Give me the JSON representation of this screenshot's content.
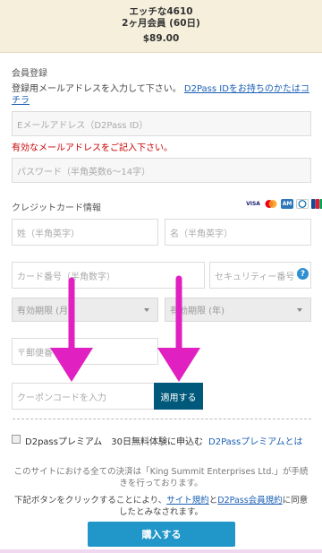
{
  "header": {
    "title": "エッチな4610",
    "plan": "2ヶ月会員 (60日)",
    "price": "$89.00"
  },
  "registration": {
    "section_label": "会員登録",
    "instruction": "登録用メールアドレスを入力して下さい。",
    "d2pass_link": "D2Pass IDをお持ちのかたはコチラ",
    "email_placeholder": "Eメールアドレス（D2Pass ID）",
    "email_error": "有効なメールアドレスをご記入下さい。",
    "password_placeholder": "パスワード（半角英数6〜14字）"
  },
  "credit_card": {
    "section_label": "クレジットカード情報",
    "brands": [
      "VISA",
      "MC",
      "AMEX",
      "DC",
      "JCB"
    ],
    "last_name_placeholder": "姓（半角英字）",
    "first_name_placeholder": "名（半角英字）",
    "card_number_placeholder": "カード番号（半角数字）",
    "security_placeholder": "セキュリティー番号",
    "help_icon": "?",
    "exp_month": "有効期限 (月)",
    "exp_year": "有効期限 (年)",
    "postal_placeholder": "〒郵便番号"
  },
  "coupon": {
    "placeholder": "クーポンコードを入力",
    "apply_label": "適用する"
  },
  "premium": {
    "label": "D2passプレミアム　30日無料体験に申込む",
    "link": "D2Passプレミアムとは"
  },
  "notice": {
    "text_1": "このサイトにおける全ての決済は「King Summit Enterprises Ltd.」が手続きを行っております。",
    "text_2_prefix": "下記ボタンをクリックすることにより、",
    "terms_link": "サイト規約",
    "and": "と",
    "member_link": "D2Pass会員規約",
    "text_2_suffix": "に同意したとみなされます。"
  },
  "purchase_button": "購入する",
  "colors": {
    "arrow": "#e020c0",
    "apply_button": "#00587a",
    "buy_button": "#2196c9",
    "header_bg": "#f5efdc"
  }
}
